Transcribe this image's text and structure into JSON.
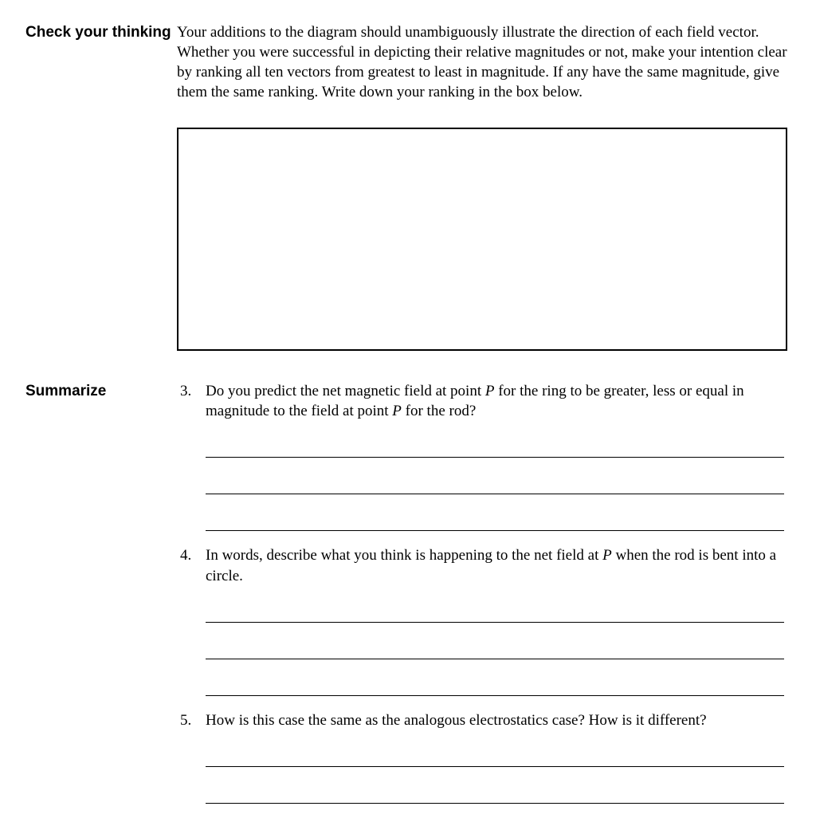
{
  "check": {
    "label": "Check your thinking",
    "instruction_parts": [
      "Your additions to the diagram should unambiguously illustrate the direction of each field vector.  Whether you were successful in depicting their relative magnitudes or not, make your intention clear by ranking all ten vectors from greatest to least in magnitude.  If any have the same magnitude, give them the same ranking.  Write down your ranking in the box below."
    ]
  },
  "summarize": {
    "label": "Summarize",
    "questions": [
      {
        "num": "3.",
        "pre1": "Do you predict the net magnetic field at point ",
        "it1": "P",
        "mid1": " for the ring to be greater, less or equal in magnitude to the field at point ",
        "it2": "P",
        "post1": " for the rod?",
        "blanks": 3
      },
      {
        "num": "4.",
        "pre1": "In words, describe what you think is happening to the net field at ",
        "it1": "P",
        "mid1": " when the rod is bent into a circle.",
        "it2": "",
        "post1": "",
        "blanks": 3
      },
      {
        "num": "5.",
        "pre1": "How is this case the same as the analogous electrostatics case?  How is it different?",
        "it1": "",
        "mid1": "",
        "it2": "",
        "post1": "",
        "blanks": 2
      }
    ]
  }
}
